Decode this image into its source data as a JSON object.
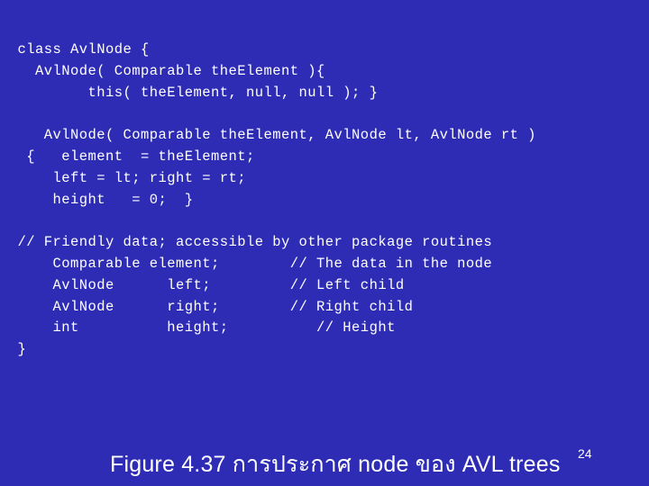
{
  "slide": {
    "background_color": "#2e2cb5",
    "text_color": "#ffffff",
    "page_number": "24",
    "caption": "Figure 4.37 การประกาศ node ของ AVL trees"
  },
  "code": {
    "language": "java",
    "lines": [
      "  class AvlNode {",
      "    AvlNode( Comparable theElement ){",
      "          this( theElement, null, null ); }",
      "",
      "     AvlNode( Comparable theElement, AvlNode lt, AvlNode rt )",
      "   {   element  = theElement;",
      "      left = lt; right = rt;",
      "      height   = 0;  }",
      "",
      "  // Friendly data; accessible by other package routines",
      "      Comparable element;        // The data in the node",
      "      AvlNode      left;         // Left child",
      "      AvlNode      right;        // Right child",
      "      int          height;          // Height",
      "  }"
    ]
  }
}
